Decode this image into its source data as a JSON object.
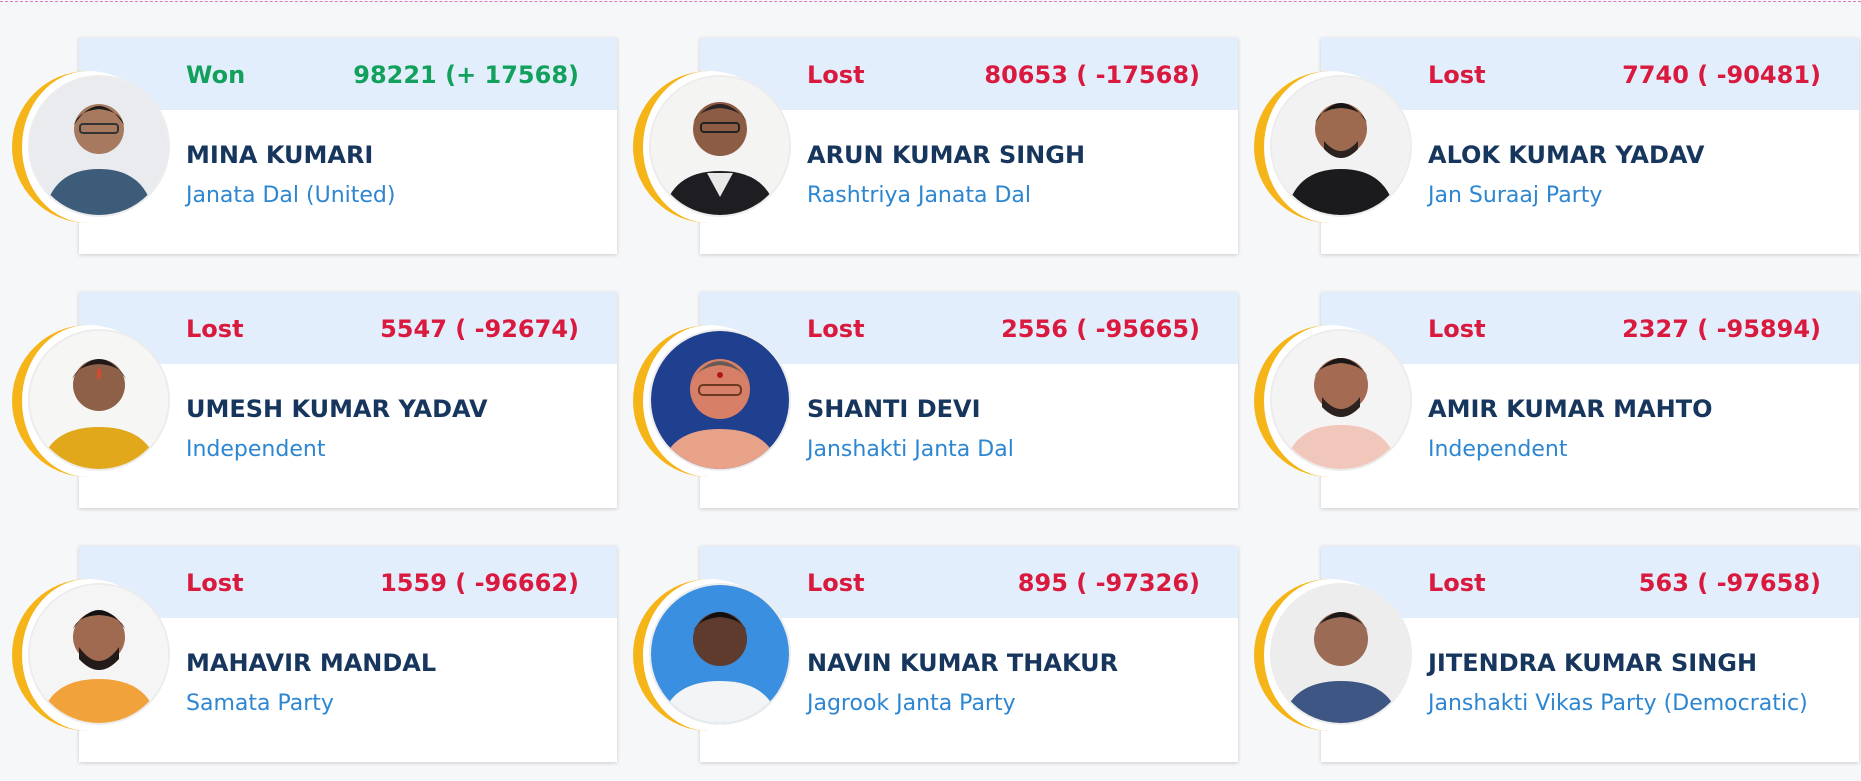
{
  "candidates": [
    {
      "status": "Won",
      "votes": "98221 (+ 17568)",
      "name": "MINA KUMARI",
      "party": "Janata Dal (United)"
    },
    {
      "status": "Lost",
      "votes": "80653 ( -17568)",
      "name": "ARUN KUMAR SINGH",
      "party": "Rashtriya Janata Dal"
    },
    {
      "status": "Lost",
      "votes": "7740 ( -90481)",
      "name": "ALOK KUMAR YADAV",
      "party": "Jan Suraaj Party"
    },
    {
      "status": "Lost",
      "votes": "5547 ( -92674)",
      "name": "UMESH KUMAR YADAV",
      "party": "Independent"
    },
    {
      "status": "Lost",
      "votes": "2556 ( -95665)",
      "name": "SHANTI DEVI",
      "party": "Janshakti Janta Dal"
    },
    {
      "status": "Lost",
      "votes": "2327 ( -95894)",
      "name": "AMIR KUMAR MAHTO",
      "party": "Independent"
    },
    {
      "status": "Lost",
      "votes": "1559 ( -96662)",
      "name": "MAHAVIR MANDAL",
      "party": "Samata Party"
    },
    {
      "status": "Lost",
      "votes": "895 ( -97326)",
      "name": "NAVIN KUMAR THAKUR",
      "party": "Jagrook Janta Party"
    },
    {
      "status": "Lost",
      "votes": "563 ( -97658)",
      "name": "JITENDRA KUMAR SINGH",
      "party": "Janshakti Vikas Party (Democratic)"
    }
  ],
  "colors": {
    "won": "#12a15c",
    "lost": "#d9193d",
    "name": "#17365d",
    "party": "#2d86d1",
    "card_header": "#e3eefc",
    "avatar_ring": "#f5b519"
  },
  "icons": {
    "avatar": "person-photo"
  }
}
